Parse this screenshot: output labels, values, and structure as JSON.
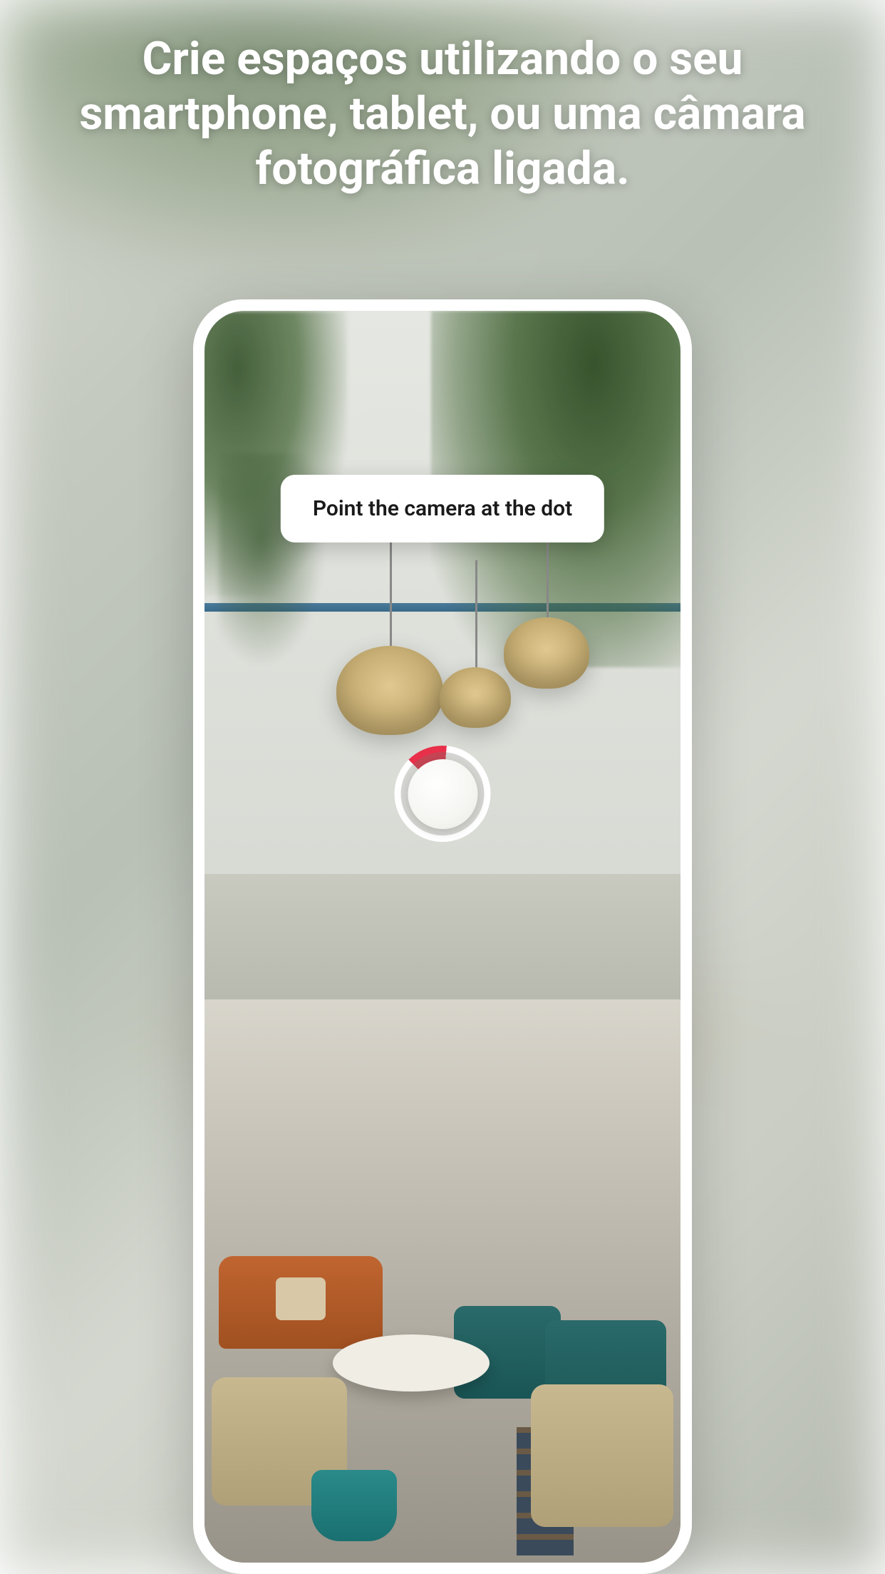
{
  "headline": "Crie espaços utilizando o seu smartphone, tablet, ou uma câmara fotográfica ligada.",
  "screen": {
    "instruction": "Point the camera at the dot"
  },
  "colors": {
    "accent": "#e8304a",
    "pill_bg": "#ffffff"
  }
}
